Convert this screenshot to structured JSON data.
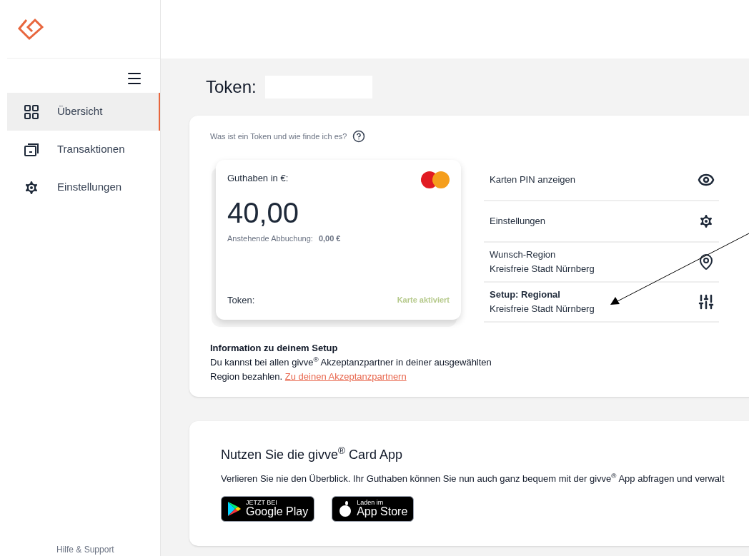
{
  "sidebar": {
    "items": [
      {
        "label": "Übersicht",
        "selected": true
      },
      {
        "label": "Transaktionen",
        "selected": false
      },
      {
        "label": "Einstellungen",
        "selected": false
      }
    ],
    "footer": "Hilfe & Support"
  },
  "page_title": "Token:",
  "token_card": {
    "help": "Was ist ein Token und wie finde ich es?",
    "balance_label": "Guthaben in €:",
    "balance": "40,00",
    "pending_label": "Anstehende Abbuchung:",
    "pending_value": "0,00 €",
    "token_label": "Token:",
    "status": "Karte aktiviert"
  },
  "actions": [
    {
      "title": "Karten PIN anzeigen",
      "bold": false
    },
    {
      "title": "Einstellungen",
      "bold": false
    },
    {
      "title": "Wunsch-Region",
      "subtitle": "Kreisfreie Stadt Nürnberg",
      "bold": false
    },
    {
      "title": "Setup: Regional",
      "subtitle": "Kreisfreie Stadt Nürnberg",
      "bold": true
    }
  ],
  "info": {
    "title": "Information zu deinem Setup",
    "text": "Du kannst bei allen givve$^{®}$ Akzeptanzpartner in deiner ausgewählten Region bezahlen.",
    "link": "Zu deinen Akzeptanzpartnern"
  },
  "app_promo": {
    "title": "Nutzen Sie die givve$^{®}$ Card App",
    "text": "Verlieren Sie nie den Überblick. Ihr Guthaben können Sie nun auch ganz bequem mit der givve$^{®}$ App abfragen und verwalt",
    "badges": [
      {
        "kind": "google",
        "small": "JETZT BEI",
        "big": "Google Play"
      },
      {
        "kind": "apple",
        "small": "Laden im",
        "big": "App Store"
      }
    ]
  }
}
